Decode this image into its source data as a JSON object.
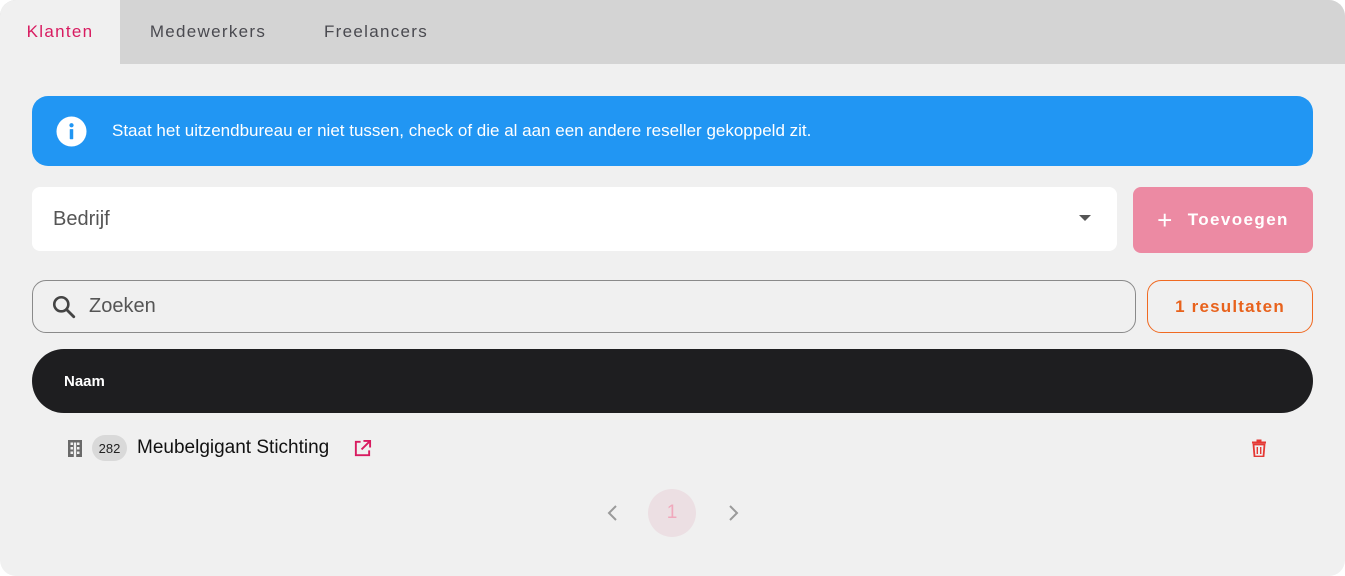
{
  "tabs": [
    {
      "label": "Klanten",
      "active": true
    },
    {
      "label": "Medewerkers",
      "active": false
    },
    {
      "label": "Freelancers",
      "active": false
    }
  ],
  "alert": {
    "icon": "info-icon",
    "text": "Staat het uitzendbureau er niet tussen, check of die al aan een andere reseller gekoppeld zit."
  },
  "company_select": {
    "value": "Bedrijf",
    "icon": "chevron-down-icon"
  },
  "add_button": {
    "icon": "plus-icon",
    "label": "Toevoegen"
  },
  "search": {
    "placeholder": "Zoeken",
    "value": "",
    "icon": "search-icon"
  },
  "results_label": "1 resultaten",
  "table": {
    "columns": [
      "Naam"
    ],
    "rows": [
      {
        "id": "282",
        "name": "Meubelgigant Stichting",
        "icon": "building-icon",
        "actions": [
          "external-link-icon",
          "trash-icon"
        ]
      }
    ]
  },
  "pagination": {
    "current_page": "1"
  },
  "colors": {
    "accent": "#d81b60",
    "alert_bg": "#2196f3",
    "add_button_bg": "#ec8aa3",
    "results_border": "#f06a22",
    "table_header_bg": "#1e1e20"
  }
}
